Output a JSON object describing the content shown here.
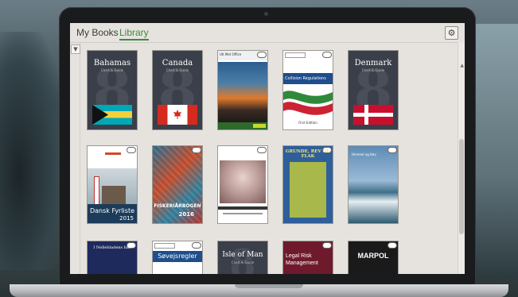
{
  "tabs": {
    "my_books": "My Books",
    "library": "Library"
  },
  "icons": {
    "settings": "gear-icon",
    "filter": "filter-icon",
    "cloud": "cloud-icon"
  },
  "books": {
    "bahamas": {
      "title": "Bahamas",
      "sub": "Chart & Guide"
    },
    "canada": {
      "title": "Canada",
      "sub": "Chart & Guide"
    },
    "clouds": {
      "title": "UK Met Office"
    },
    "collision": {
      "title": "Collision Regulations",
      "edition": "First Edition"
    },
    "denmark": {
      "title": "Denmark",
      "sub": "Chart & Guide"
    },
    "fyrliste": {
      "title": "Dansk Fyrliste",
      "year": "2015"
    },
    "fisker": {
      "title": "FISKERIÅRBOGEN",
      "year": "2016"
    },
    "vintage": {
      "title": "Book"
    },
    "grunde": {
      "title": "GRUNDE, REV OG FLAK"
    },
    "havet": {
      "title": "Himmel og Hav"
    },
    "isle_of_man": {
      "title": "Isle of Man",
      "sub": "Chart & Guide"
    },
    "legal_risk": {
      "title": "Legal Risk Management"
    },
    "marpol": {
      "title": "MARPOL"
    },
    "nordsoen": {
      "title": "I Nellebladens hav"
    },
    "sovej": {
      "title": "Søvejsregler"
    }
  },
  "colors": {
    "accent": "#3f8b3a",
    "cover_dark": "#3b3f4a"
  }
}
